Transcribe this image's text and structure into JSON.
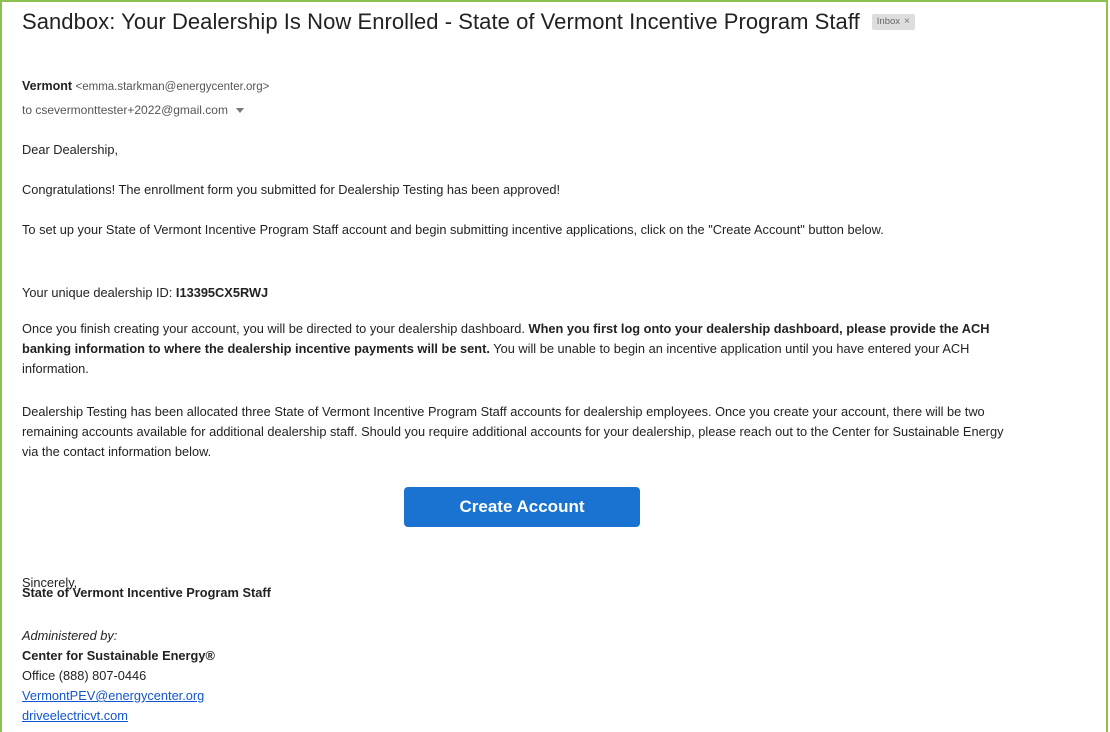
{
  "email": {
    "subject": "Sandbox: Your Dealership Is Now Enrolled - State of Vermont Incentive Program Staff",
    "label_chip": "Inbox",
    "label_chip_close": "×",
    "sender": {
      "name": "Vermont",
      "address": "<emma.starkman@energycenter.org>"
    },
    "recipient": "to csevermonttester+2022@gmail.com",
    "body": {
      "greeting": "Dear Dealership,",
      "congrats": "Congratulations! The enrollment form you submitted for Dealership Testing has been approved!",
      "setup": "To set up your State of Vermont Incentive Program Staff account and begin submitting incentive applications, click on the \"Create Account\" button below.",
      "dealer_id_label": "Your unique dealership ID: ",
      "dealer_id_value": "I13395CX5RWJ",
      "dashboard_intro": "Once you finish creating your account, you will be directed to your dealership dashboard. ",
      "dashboard_bold": "When you first log onto your dealership dashboard, please provide the ACH banking information to where the dealership incentive payments will be sent.",
      "dashboard_rest": " You will be unable to begin an incentive application until you have entered your ACH information.",
      "allocation": "Dealership Testing has been allocated three State of Vermont Incentive Program Staff accounts for dealership employees. Once you create your account, there will be two remaining accounts available for additional dealership staff. Should you require additional accounts for your dealership, please reach out to the Center for Sustainable Energy via the contact information below.",
      "button_label": "Create Account",
      "closing": "Sincerely,",
      "signature": "State of Vermont Incentive Program Staff",
      "administered_by": "Administered by:",
      "org_name": "Center for Sustainable Energy®",
      "office_phone": "Office (888) 807-0446",
      "contact_email": "VermontPEV@energycenter.org",
      "website": "driveelectricvt.com"
    }
  },
  "colors": {
    "button": "#1a73d1",
    "link": "#1155cc",
    "frame": "#8cc152"
  }
}
